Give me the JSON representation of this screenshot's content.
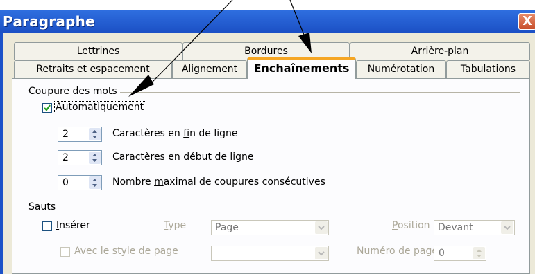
{
  "window": {
    "title": "Paragraphe",
    "close_label": "X"
  },
  "tabs": {
    "row_back": [
      "Lettrines",
      "Bordures",
      "Arrière-plan"
    ],
    "row_front": [
      "Retraits et espacement",
      "Alignement",
      "Enchaînements",
      "Numérotation",
      "Tabulations"
    ],
    "active": "Enchaînements"
  },
  "hyphenation": {
    "section_title": "Coupure des mots",
    "auto": {
      "pre": "",
      "accel": "A",
      "post": "utomatiquement",
      "checked": true
    },
    "rows": [
      {
        "value": "2",
        "pre": "Caractères en ",
        "accel": "f",
        "post": "in de ligne"
      },
      {
        "value": "2",
        "pre": "Caractères en ",
        "accel": "d",
        "post": "ébut de ligne"
      },
      {
        "value": "0",
        "pre": "Nombre ",
        "accel": "m",
        "post": "aximal de coupures consécutives"
      }
    ]
  },
  "breaks": {
    "section_title": "Sauts",
    "insert": {
      "pre": "",
      "accel": "I",
      "post": "nsérer",
      "checked": false
    },
    "type_label": {
      "pre": "",
      "accel": "T",
      "post": "ype"
    },
    "type_value": "Page",
    "position_label": {
      "pre": "",
      "accel": "P",
      "post": "osition"
    },
    "position_value": "Devant",
    "page_style": {
      "pre": "Avec le ",
      "accel": "s",
      "post": "tyle de page",
      "checked": false
    },
    "page_style_value": "",
    "page_number_label": {
      "pre": "",
      "accel": "N",
      "post": "uméro de page"
    },
    "page_number_value": "0"
  },
  "colors": {
    "title_bar": "#1b4fc4",
    "tab_active_accent": "#f5a623",
    "check_green": "#21a121",
    "disabled_text": "#aca899"
  }
}
